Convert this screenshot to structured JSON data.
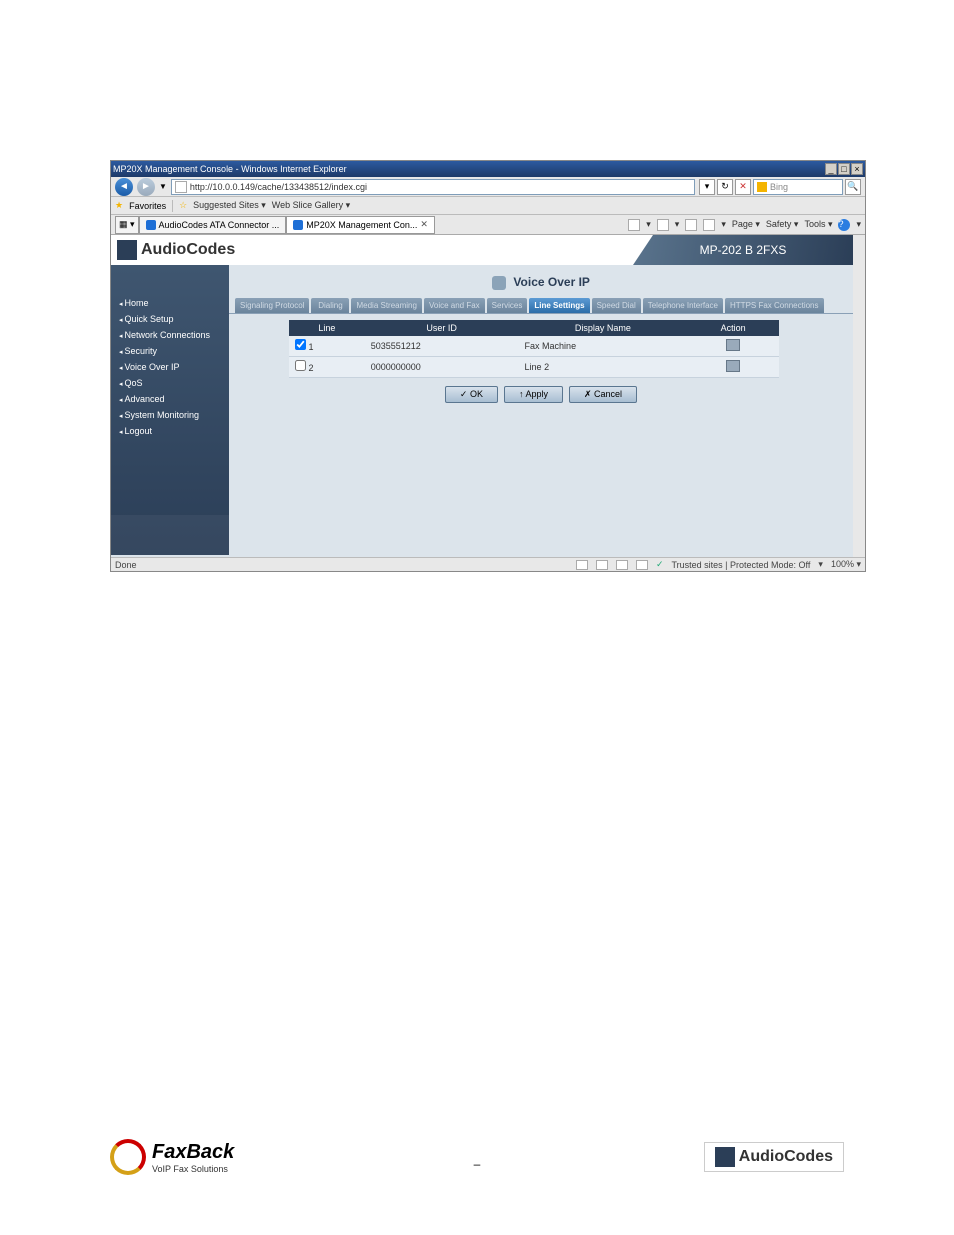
{
  "browser": {
    "title": "MP20X Management Console - Windows Internet Explorer",
    "window_buttons": {
      "min": "_",
      "max": "□",
      "close": "×"
    },
    "url": "http://10.0.0.149/cache/133438512/index.cgi",
    "search_engine": "Bing",
    "favorites_label": "Favorites",
    "fav_links": [
      "Suggested Sites ▾",
      "Web Slice Gallery ▾"
    ],
    "tabs": [
      {
        "label": "AudioCodes ATA Connector ...",
        "active": false
      },
      {
        "label": "MP20X Management Con...",
        "active": true
      }
    ],
    "toolbar_items": [
      "Page ▾",
      "Safety ▾",
      "Tools ▾"
    ],
    "status_left": "Done",
    "status_trust": "Trusted sites | Protected Mode: Off",
    "status_zoom": "100%"
  },
  "app": {
    "logo_text": "AudioCodes",
    "model": "MP-202 B 2FXS",
    "page_title": "Voice Over IP",
    "sidebar": [
      "Home",
      "Quick Setup",
      "Network Connections",
      "Security",
      "Voice Over IP",
      "QoS",
      "Advanced",
      "System Monitoring",
      "Logout"
    ],
    "tabs": [
      "Signaling Protocol",
      "Dialing",
      "Media Streaming",
      "Voice and Fax",
      "Services",
      "Line Settings",
      "Speed Dial",
      "Telephone Interface",
      "HTTPS Fax Connections"
    ],
    "active_tab": "Line Settings",
    "table": {
      "headers": [
        "Line",
        "User ID",
        "Display Name",
        "Action"
      ],
      "rows": [
        {
          "checked": true,
          "line": "1",
          "user_id": "5035551212",
          "display_name": "Fax Machine"
        },
        {
          "checked": false,
          "line": "2",
          "user_id": "0000000000",
          "display_name": "Line 2"
        }
      ]
    },
    "buttons": {
      "ok": "✓ OK",
      "apply": "↑ Apply",
      "cancel": "✗ Cancel"
    }
  },
  "footer": {
    "faxback_name": "FaxBack",
    "faxback_tag": "VoIP Fax Solutions",
    "audiocodes": "AudioCodes"
  }
}
